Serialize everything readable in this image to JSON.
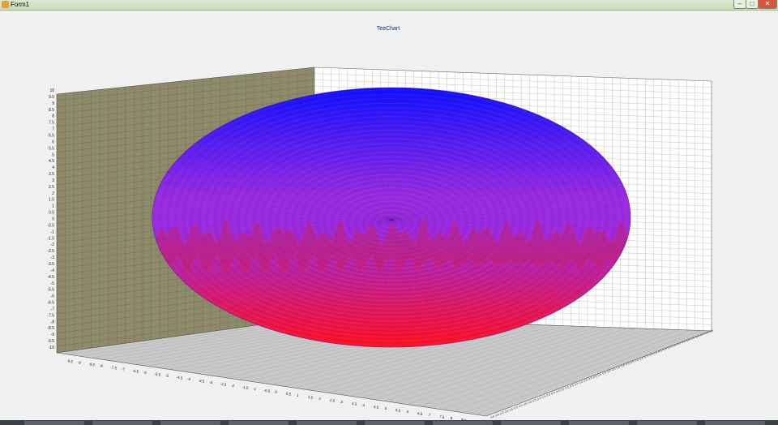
{
  "window": {
    "title": "Form1",
    "min_label": "–",
    "max_label": "□",
    "close_label": "✕"
  },
  "chart_data": {
    "type": "surface3d",
    "title": "TeeChart",
    "shape": "ellipsoid",
    "y_axis": {
      "range": [
        -10,
        10
      ],
      "step": 0.5,
      "tick_labels": [
        "-10",
        "-9.5",
        "-9",
        "-8.5",
        "-8",
        "-7.5",
        "-7",
        "-6.5",
        "-6",
        "-5.5",
        "-5",
        "-4.5",
        "-4",
        "-3.5",
        "-3",
        "-2.5",
        "-2",
        "-1.5",
        "-1",
        "-0.5",
        "0",
        "0.5",
        "1",
        "1.5",
        "2",
        "2.5",
        "3",
        "3.5",
        "4",
        "4.5",
        "5",
        "5.5",
        "6",
        "6.5",
        "7",
        "7.5",
        "8",
        "8.5",
        "9",
        "9.5",
        "10"
      ]
    },
    "x_axis": {
      "range": [
        -9.5,
        9.5
      ],
      "step": 0.5,
      "tick_labels": [
        "-9.5",
        "-9",
        "-8.5",
        "-8",
        "-7.5",
        "-7",
        "-6.5",
        "-6",
        "-5.5",
        "-5",
        "-4.5",
        "-4",
        "-3.5",
        "-3",
        "-2.5",
        "-2",
        "-1.5",
        "-1",
        "-0.5",
        "0",
        "0.5",
        "1",
        "1.5",
        "2",
        "2.5",
        "3",
        "3.5",
        "4",
        "4.5",
        "5",
        "5.5",
        "6",
        "6.5",
        "7",
        "7.5",
        "8",
        "8.5",
        "9",
        "9.5"
      ]
    },
    "colors": {
      "top": "#1010ff",
      "middle": "#9a2be0",
      "bottom": "#ff1020",
      "left_wall": "#8d8a6a",
      "back_wall": "#ffffff",
      "floor": "#c8c8c8",
      "grid": "#b0b0b0"
    },
    "grid": true
  },
  "taskbar": {
    "items": [
      "",
      "",
      "",
      "",
      "",
      "",
      "",
      "",
      "",
      "",
      ""
    ]
  }
}
